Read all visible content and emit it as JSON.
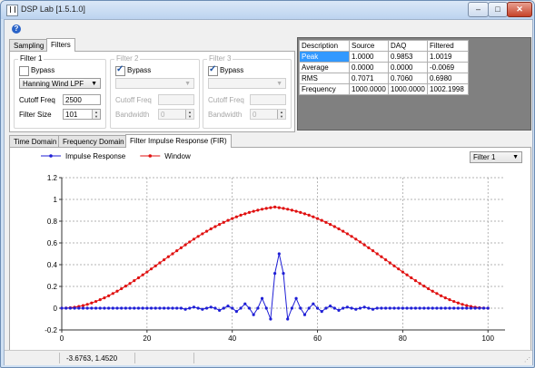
{
  "window": {
    "title": "DSP Lab [1.5.1.0]",
    "min_label": "–",
    "max_label": "□",
    "close_label": "✕"
  },
  "help_icon": "?",
  "top_tabs": [
    "Sampling",
    "Filters"
  ],
  "filters": {
    "filter1": {
      "title": "Filter 1",
      "bypass": "Bypass",
      "bypass_checked": false,
      "type": "Hanning Wind LPF",
      "cutoff_label": "Cutoff Freq",
      "cutoff_value": "2500",
      "size_label": "Filter Size",
      "size_value": "101"
    },
    "filter2": {
      "title": "Filter 2",
      "bypass": "Bypass",
      "bypass_checked": true,
      "type": "",
      "cutoff_label": "Cutoff Freq",
      "cutoff_value": "",
      "bandwidth_label": "Bandwidth",
      "bandwidth_value": "0"
    },
    "filter3": {
      "title": "Filter 3",
      "bypass": "Bypass",
      "bypass_checked": true,
      "type": "",
      "cutoff_label": "Cutoff Freq",
      "cutoff_value": "",
      "bandwidth_label": "Bandwidth",
      "bandwidth_value": "0"
    }
  },
  "stats_table": {
    "headers": [
      "Description",
      "Source",
      "DAQ",
      "Filtered"
    ],
    "rows": [
      [
        "Peak",
        "1.0000",
        "0.9853",
        "1.0019"
      ],
      [
        "Average",
        "0.0000",
        "0.0000",
        "-0.0069"
      ],
      [
        "RMS",
        "0.7071",
        "0.7060",
        "0.6980"
      ],
      [
        "Frequency",
        "1000.0000",
        "1000.0000",
        "1002.1998"
      ]
    ]
  },
  "chart_tabs": [
    "Time Domain",
    "Frequency Domain",
    "Filter Impulse Response (FIR)"
  ],
  "chart_filter_select": "Filter 1",
  "status": {
    "coords": "-3.6763, 1.4520"
  },
  "colors": {
    "impulse": "#1f1fd6",
    "window": "#e01010",
    "selection": "#3399ff"
  },
  "chart_data": {
    "type": "line",
    "legend": [
      "Impulse Response",
      "Window"
    ],
    "legend_placement": "top-left",
    "xlim": [
      0,
      104
    ],
    "ylim": [
      -0.2,
      1.2
    ],
    "xticks": [
      0,
      20,
      40,
      60,
      80,
      100
    ],
    "yticks": [
      -0.2,
      0,
      0.2,
      0.4,
      0.6,
      0.8,
      1,
      1.2
    ],
    "grid": true,
    "series": [
      {
        "name": "Impulse Response",
        "x": [
          0,
          1,
          2,
          3,
          4,
          5,
          6,
          7,
          8,
          9,
          10,
          11,
          12,
          13,
          14,
          15,
          16,
          17,
          18,
          19,
          20,
          21,
          22,
          23,
          24,
          25,
          26,
          27,
          28,
          29,
          30,
          31,
          32,
          33,
          34,
          35,
          36,
          37,
          38,
          39,
          40,
          41,
          42,
          43,
          44,
          45,
          46,
          47,
          48,
          49,
          50,
          51,
          52,
          53,
          54,
          55,
          56,
          57,
          58,
          59,
          60,
          61,
          62,
          63,
          64,
          65,
          66,
          67,
          68,
          69,
          70,
          71,
          72,
          73,
          74,
          75,
          76,
          77,
          78,
          79,
          80,
          81,
          82,
          83,
          84,
          85,
          86,
          87,
          88,
          89,
          90,
          91,
          92,
          93,
          94,
          95,
          96,
          97,
          98,
          99,
          100
        ],
        "y": [
          0,
          0,
          0,
          0,
          0,
          0,
          0,
          0,
          0,
          0,
          0,
          0,
          0,
          0,
          0,
          0,
          0,
          0,
          0,
          0,
          0,
          0,
          0,
          0,
          0,
          0,
          0,
          0,
          0,
          -0.01,
          0,
          0.01,
          0,
          -0.01,
          0,
          0.01,
          0,
          -0.02,
          0,
          0.02,
          0,
          -0.03,
          0,
          0.04,
          0,
          -0.06,
          0,
          0.09,
          0,
          -0.1,
          0.32,
          0.5,
          0.32,
          -0.1,
          0,
          0.09,
          0,
          -0.06,
          0,
          0.04,
          0,
          -0.03,
          0,
          0.02,
          0,
          -0.02,
          0,
          0.01,
          0,
          -0.01,
          0,
          0.01,
          0,
          -0.01,
          0,
          0,
          0,
          0,
          0,
          0,
          0,
          0,
          0,
          0,
          0,
          0,
          0,
          0,
          0,
          0,
          0,
          0,
          0,
          0,
          0,
          0,
          0,
          0,
          0,
          0,
          0
        ]
      },
      {
        "name": "Window",
        "x": [
          0,
          1,
          2,
          3,
          4,
          5,
          6,
          7,
          8,
          9,
          10,
          11,
          12,
          13,
          14,
          15,
          16,
          17,
          18,
          19,
          20,
          21,
          22,
          23,
          24,
          25,
          26,
          27,
          28,
          29,
          30,
          31,
          32,
          33,
          34,
          35,
          36,
          37,
          38,
          39,
          40,
          41,
          42,
          43,
          44,
          45,
          46,
          47,
          48,
          49,
          50,
          51,
          52,
          53,
          54,
          55,
          56,
          57,
          58,
          59,
          60,
          61,
          62,
          63,
          64,
          65,
          66,
          67,
          68,
          69,
          70,
          71,
          72,
          73,
          74,
          75,
          76,
          77,
          78,
          79,
          80,
          81,
          82,
          83,
          84,
          85,
          86,
          87,
          88,
          89,
          90,
          91,
          92,
          93,
          94,
          95,
          96,
          97,
          98,
          99,
          100
        ],
        "y": [
          0,
          0.001,
          0.004,
          0.009,
          0.016,
          0.024,
          0.035,
          0.048,
          0.062,
          0.078,
          0.095,
          0.114,
          0.135,
          0.156,
          0.179,
          0.203,
          0.227,
          0.253,
          0.279,
          0.306,
          0.333,
          0.361,
          0.389,
          0.417,
          0.445,
          0.473,
          0.5,
          0.528,
          0.555,
          0.582,
          0.609,
          0.635,
          0.66,
          0.684,
          0.707,
          0.729,
          0.75,
          0.77,
          0.789,
          0.807,
          0.824,
          0.84,
          0.855,
          0.868,
          0.88,
          0.891,
          0.901,
          0.91,
          0.918,
          0.924,
          0.93,
          0.924,
          0.918,
          0.91,
          0.901,
          0.891,
          0.88,
          0.868,
          0.855,
          0.84,
          0.824,
          0.807,
          0.789,
          0.77,
          0.75,
          0.729,
          0.707,
          0.684,
          0.66,
          0.635,
          0.609,
          0.582,
          0.555,
          0.528,
          0.5,
          0.473,
          0.445,
          0.417,
          0.389,
          0.361,
          0.333,
          0.306,
          0.279,
          0.253,
          0.227,
          0.203,
          0.179,
          0.156,
          0.135,
          0.114,
          0.095,
          0.078,
          0.062,
          0.048,
          0.035,
          0.024,
          0.016,
          0.009,
          0.004,
          0.001,
          0
        ]
      }
    ]
  }
}
